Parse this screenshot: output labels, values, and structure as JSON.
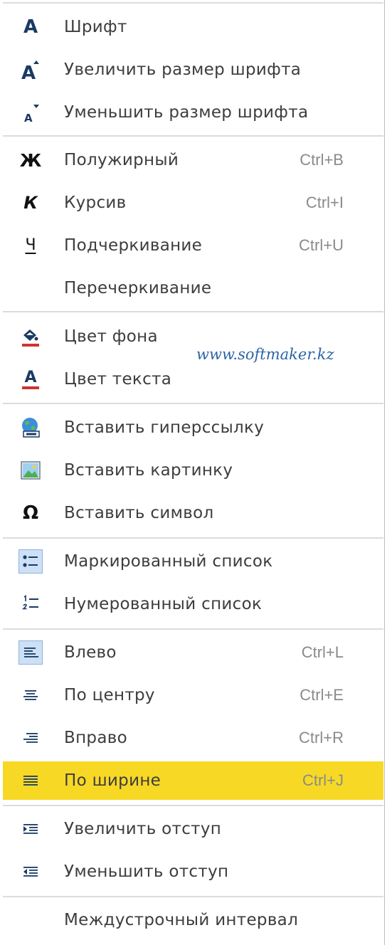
{
  "items": [
    {
      "label": "Шрифт",
      "shortcut": ""
    },
    {
      "label": "Увеличить размер шрифта",
      "shortcut": ""
    },
    {
      "label": "Уменьшить размер шрифта",
      "shortcut": ""
    },
    {
      "label": "Полужирный",
      "shortcut": "Ctrl+B"
    },
    {
      "label": "Курсив",
      "shortcut": "Ctrl+I"
    },
    {
      "label": "Подчеркивание",
      "shortcut": "Ctrl+U"
    },
    {
      "label": "Перечеркивание",
      "shortcut": ""
    },
    {
      "label": "Цвет фона",
      "shortcut": ""
    },
    {
      "label": "Цвет текста",
      "shortcut": ""
    },
    {
      "label": "Вставить гиперссылку",
      "shortcut": ""
    },
    {
      "label": "Вставить картинку",
      "shortcut": ""
    },
    {
      "label": "Вставить символ",
      "shortcut": ""
    },
    {
      "label": "Маркированный список",
      "shortcut": ""
    },
    {
      "label": "Нумерованный список",
      "shortcut": ""
    },
    {
      "label": "Влево",
      "shortcut": "Ctrl+L"
    },
    {
      "label": "По центру",
      "shortcut": "Ctrl+E"
    },
    {
      "label": "Вправо",
      "shortcut": "Ctrl+R"
    },
    {
      "label": "По ширине",
      "shortcut": "Ctrl+J"
    },
    {
      "label": "Увеличить отступ",
      "shortcut": ""
    },
    {
      "label": "Уменьшить отступ",
      "shortcut": ""
    },
    {
      "label": "Междустрочный интервал",
      "shortcut": ""
    }
  ],
  "icons": {
    "font": "A",
    "bold": "Ж",
    "italic": "К",
    "underline": "Ч",
    "text_color": "A",
    "symbol": "Ω"
  },
  "watermark": "www.softmaker.kz",
  "colors": {
    "highlight": "#f7d925",
    "selected_icon_bg": "#cde0f6",
    "text": "#3d3d3d",
    "shortcut": "#8a8a8a",
    "watermark": "#2e63a6",
    "icon_dark": "#1a3a63",
    "underline_red": "#d0332f"
  }
}
